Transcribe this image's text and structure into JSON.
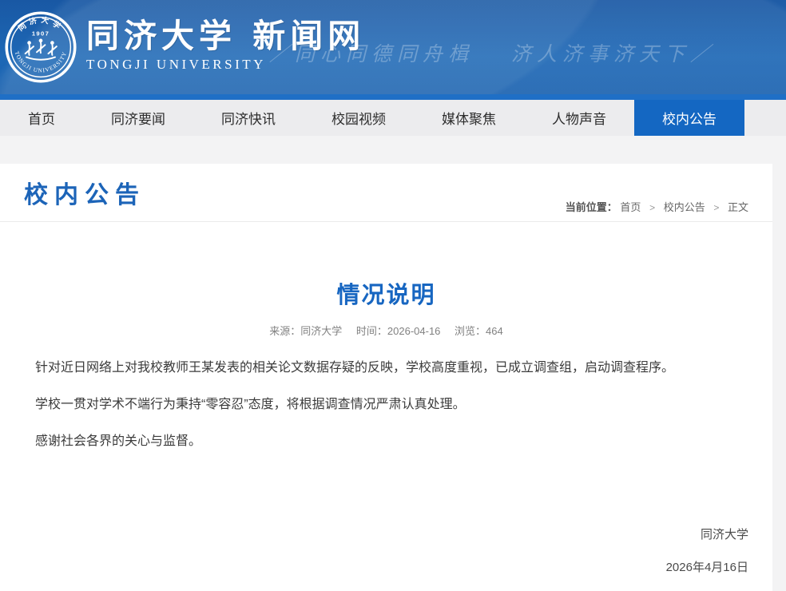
{
  "header": {
    "site_name_cn": "同济大学 新闻网",
    "site_name_en": "TONGJI UNIVERSITY",
    "slogan": "／同心同德同舟楫　 济人济事济天下／",
    "logo": {
      "arc_top_cn": "同济大学",
      "year": "1907",
      "arc_bottom_en": "TONGJI UNIVERSITY"
    },
    "colors": {
      "header_blue": "#0f5aab",
      "accent_line_blue": "#1f6fc6"
    }
  },
  "nav": {
    "active_color": "#1467c2",
    "items": [
      {
        "label": "首页"
      },
      {
        "label": "同济要闻"
      },
      {
        "label": "同济快讯"
      },
      {
        "label": "校园视频"
      },
      {
        "label": "媒体聚焦"
      },
      {
        "label": "人物声音"
      },
      {
        "label": "校内公告"
      }
    ],
    "active_index": 6
  },
  "page": {
    "section_title": "校内公告",
    "breadcrumb": {
      "label": "当前位置：",
      "home": "首页",
      "section": "校内公告",
      "current": "正文",
      "separator": ">"
    }
  },
  "article": {
    "title": "情况说明",
    "title_color": "#1766c1",
    "meta": {
      "source_label": "来源：",
      "source": "同济大学",
      "time_label": "时间：",
      "time": "2026-04-16",
      "views_label": "浏览：",
      "views": "464"
    },
    "paragraphs": [
      "针对近日网络上对我校教师王某发表的相关论文数据存疑的反映，学校高度重视，已成立调查组，启动调查程序。",
      "学校一贯对学术不端行为秉持“零容忍”态度，将根据调查情况严肃认真处理。",
      "感谢社会各界的关心与监督。"
    ],
    "signature": {
      "name": "同济大学",
      "date": "2026年4月16日"
    }
  }
}
